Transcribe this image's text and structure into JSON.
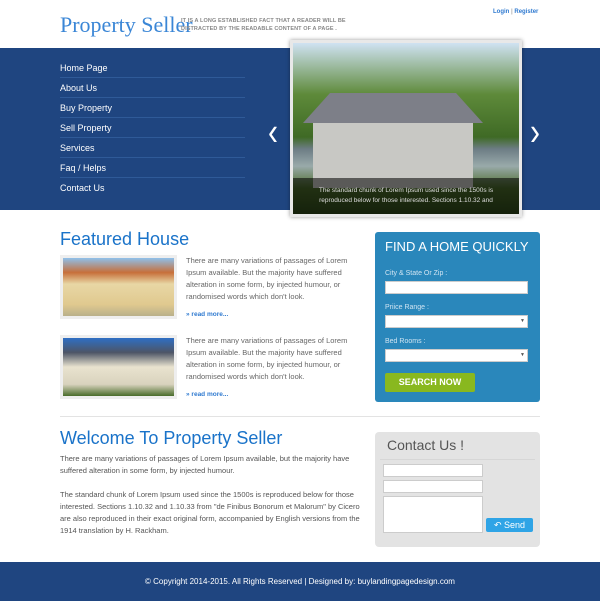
{
  "header": {
    "logo": "Property Seller",
    "tagline": "IT IS A LONG ESTABLISHED FACT THAT A READER WILL BE DISTRACTED BY THE READABLE CONTENT OF A PAGE .",
    "login": "Login",
    "sep": "|",
    "register": "Register"
  },
  "nav": [
    "Home Page",
    "About Us",
    "Buy Property",
    "Sell Property",
    "Services",
    "Faq / Helps",
    "Contact Us"
  ],
  "slider": {
    "caption": "The standard chunk of Lorem Ipsum used since the 1500s is reproduced below for those interested. Sections 1.10.32 and",
    "prev": "‹",
    "next": "›"
  },
  "featured": {
    "title": "Featured House",
    "items": [
      {
        "text": "There are many variations of passages of Lorem Ipsum available. But the majority have suffered alteration in some form, by injected humour, or randomised words which don't look.",
        "more": "» read more..."
      },
      {
        "text": "There are many variations of passages of Lorem Ipsum available. But the majority have suffered alteration in some form, by injected humour, or randomised words which don't look.",
        "more": "» read more..."
      }
    ]
  },
  "find": {
    "title": "FIND A HOME QUICKLY",
    "city_label": "City & State Or Zip :",
    "price_label": "Priice Range :",
    "bed_label": "Bed Rooms :",
    "button": "SEARCH NOW"
  },
  "welcome": {
    "title": "Welcome To Property Seller",
    "p1": "There are many variations of passages of Lorem Ipsum available, but the majority have suffered alteration in some form, by injected humour.",
    "p2": "The standard chunk of Lorem Ipsum used since the 1500s is reproduced below for those interested. Sections 1.10.32 and 1.10.33 from \"de Finibus Bonorum et Malorum\" by Cicero are also reproduced in their exact original form, accompanied by English versions from the 1914 translation by H. Rackham."
  },
  "contact": {
    "title": "Contact Us !",
    "send": "Send"
  },
  "footer": "© Copyright 2014-2015. All Rights Reserved  |  Designed by: buylandingpagedesign.com"
}
